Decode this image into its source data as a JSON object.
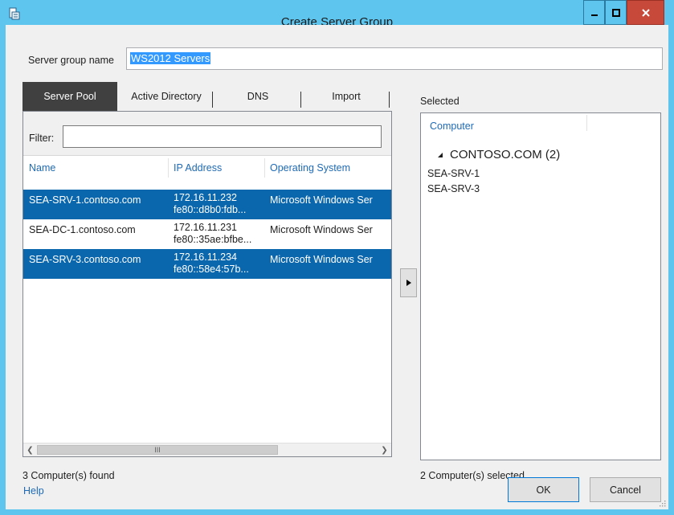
{
  "window": {
    "title": "Create Server Group",
    "controls": {
      "minimize": "minimize",
      "maximize": "maximize",
      "close": "x"
    }
  },
  "group_name": {
    "label": "Server group name",
    "value": "WS2012 Servers"
  },
  "tabs": [
    {
      "label": "Server Pool",
      "active": true
    },
    {
      "label": "Active Directory",
      "active": false
    },
    {
      "label": "DNS",
      "active": false
    },
    {
      "label": "Import",
      "active": false
    }
  ],
  "filter": {
    "label": "Filter:",
    "value": ""
  },
  "table": {
    "columns": [
      "Name",
      "IP Address",
      "Operating System"
    ],
    "rows": [
      {
        "name": "SEA-SRV-1.contoso.com",
        "ip1": "172.16.11.232",
        "ip2": "fe80::d8b0:fdb...",
        "os": "Microsoft Windows Ser",
        "selected": true
      },
      {
        "name": "SEA-DC-1.contoso.com",
        "ip1": "172.16.11.231",
        "ip2": "fe80::35ae:bfbe...",
        "os": "Microsoft Windows Ser",
        "selected": false
      },
      {
        "name": "SEA-SRV-3.contoso.com",
        "ip1": "172.16.11.234",
        "ip2": "fe80::58e4:57b...",
        "os": "Microsoft Windows Ser",
        "selected": true
      }
    ],
    "scroll_thumb_glyph": "III"
  },
  "found_text": "3 Computer(s) found",
  "selected_panel": {
    "label": "Selected",
    "column": "Computer",
    "group": "CONTOSO.COM (2)",
    "items": [
      "SEA-SRV-1",
      "SEA-SRV-3"
    ],
    "count_text": "2 Computer(s) selected"
  },
  "footer": {
    "help": "Help",
    "ok": "OK",
    "cancel": "Cancel"
  },
  "colors": {
    "title_bar": "#5dc5ee",
    "selection": "#0b67ad",
    "link": "#1e6ab5",
    "close_button": "#c7493a"
  }
}
